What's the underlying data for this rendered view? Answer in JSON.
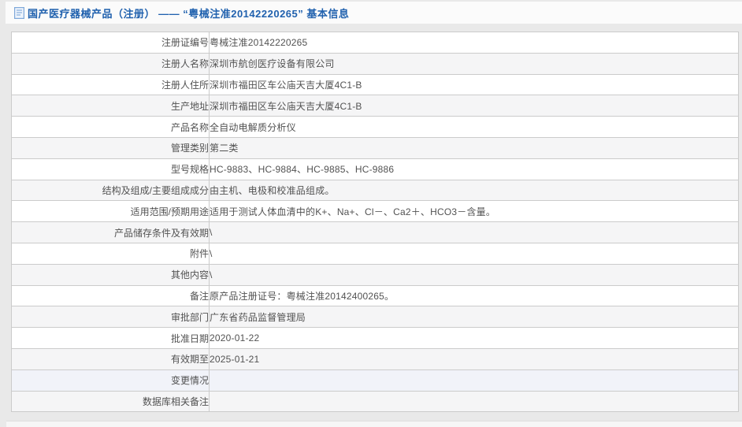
{
  "page": {
    "title": "国产医疗器械产品（注册） —— “粤械注准20142220265” 基本信息"
  },
  "colors": {
    "title_blue": "#2061ae",
    "page_bg": "#e9e9e9",
    "row_alt": "#f5f5f6",
    "row_highlight": "#f1f3f9",
    "border": "#cbcbcb",
    "text": "#525252"
  },
  "table": {
    "rows": [
      {
        "label": "注册证编号",
        "value": "粤械注准20142220265"
      },
      {
        "label": "注册人名称",
        "value": "深圳市航创医疗设备有限公司"
      },
      {
        "label": "注册人住所",
        "value": "深圳市福田区车公庙天吉大厦4C1-B"
      },
      {
        "label": "生产地址",
        "value": "深圳市福田区车公庙天吉大厦4C1-B"
      },
      {
        "label": "产品名称",
        "value": "全自动电解质分析仪"
      },
      {
        "label": "管理类别",
        "value": "第二类"
      },
      {
        "label": "型号规格",
        "value": "HC-9883、HC-9884、HC-9885、HC-9886"
      },
      {
        "label": "结构及组成/主要组成成分",
        "value": "由主机、电极和校准品组成。"
      },
      {
        "label": "适用范围/预期用途",
        "value": "适用于测试人体血清中的K+、Na+、Cl－、Ca2＋、HCO3－含量。"
      },
      {
        "label": "产品储存条件及有效期",
        "value": "\\"
      },
      {
        "label": "附件",
        "value": "\\"
      },
      {
        "label": "其他内容",
        "value": "\\"
      },
      {
        "label": "备注",
        "value": "原产品注册证号：粤械注准20142400265。"
      },
      {
        "label": "审批部门",
        "value": "广东省药品监督管理局"
      },
      {
        "label": "批准日期",
        "value": "2020-01-22"
      },
      {
        "label": "有效期至",
        "value": "2025-01-21"
      },
      {
        "label": "变更情况",
        "value": "",
        "highlighted": true
      },
      {
        "label": "数据库相关备注",
        "value": ""
      }
    ]
  }
}
